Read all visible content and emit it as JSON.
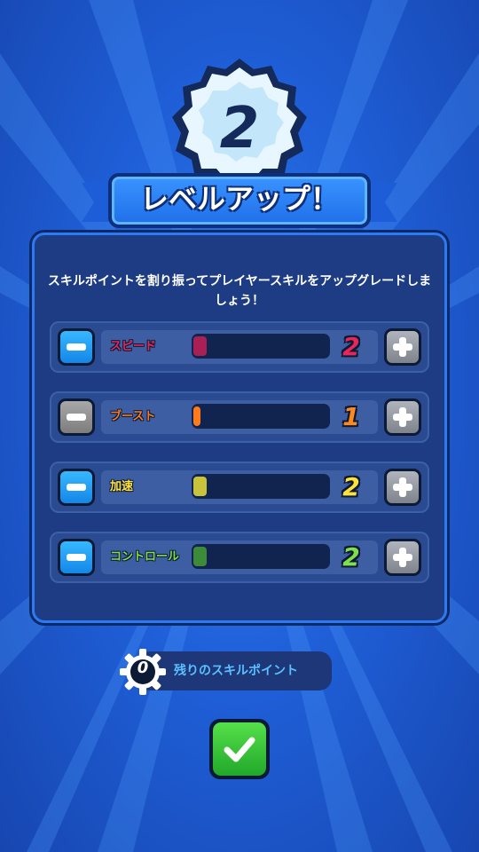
{
  "level": {
    "number": "2"
  },
  "title": "レベルアップ！",
  "instruction": "スキルポイントを割り振ってプレイヤースキルをアップグレードしましょう！",
  "skills": [
    {
      "name": "スピード",
      "value": "2",
      "level_fraction": 0.1,
      "name_color": "#e8265a",
      "value_color": "#e8265a",
      "fill_color": "#a82055",
      "minus_enabled": true
    },
    {
      "name": "ブースト",
      "value": "1",
      "level_fraction": 0.05,
      "name_color": "#ff7a1a",
      "value_color": "#ff8a1a",
      "fill_color": "#ff7a1a",
      "minus_enabled": false
    },
    {
      "name": "加速",
      "value": "2",
      "level_fraction": 0.1,
      "name_color": "#ffe23a",
      "value_color": "#ffe23a",
      "fill_color": "#c8c33a",
      "minus_enabled": true
    },
    {
      "name": "コントロール",
      "value": "2",
      "level_fraction": 0.1,
      "name_color": "#7ee04a",
      "value_color": "#7ee04a",
      "fill_color": "#3c8a3a",
      "minus_enabled": true
    }
  ],
  "remaining": {
    "value": "0",
    "label": "残りのスキルポイント"
  },
  "colors": {
    "background": "#1f5fd8",
    "panel": "#1e3c83",
    "confirm": "#2fc237"
  }
}
